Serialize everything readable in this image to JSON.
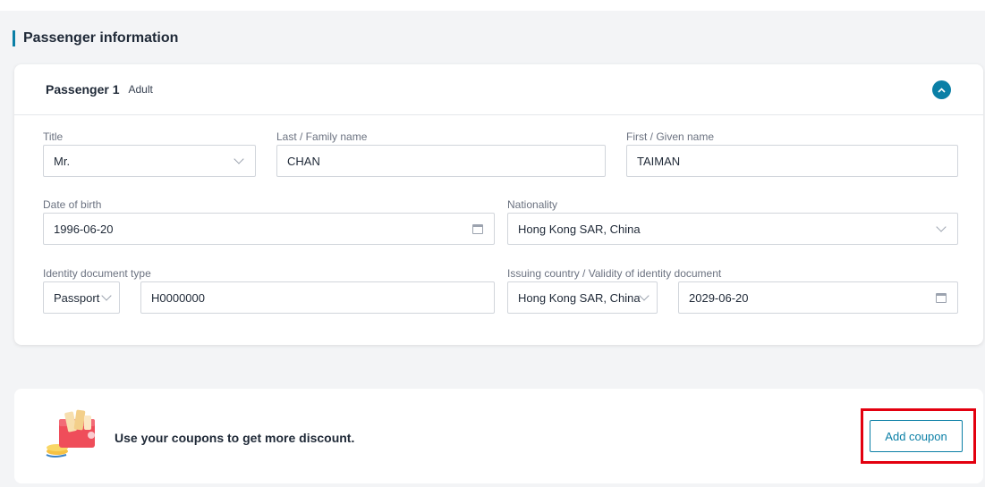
{
  "section": {
    "title": "Passenger information"
  },
  "passenger": {
    "name": "Passenger 1",
    "type": "Adult",
    "fields": {
      "title": {
        "label": "Title",
        "value": "Mr."
      },
      "last_name": {
        "label": "Last / Family name",
        "value": "CHAN"
      },
      "first_name": {
        "label": "First / Given name",
        "value": "TAIMAN"
      },
      "dob": {
        "label": "Date of birth",
        "value": "1996-06-20"
      },
      "nationality": {
        "label": "Nationality",
        "value": "Hong Kong SAR, China"
      },
      "id_doc_type": {
        "label": "Identity document type",
        "type_value": "Passport",
        "number_value": "H0000000"
      },
      "issuing": {
        "label": "Issuing country / Validity of identity document",
        "country_value": "Hong Kong SAR, China",
        "validity_value": "2029-06-20"
      }
    }
  },
  "coupon": {
    "message": "Use your coupons to get more discount.",
    "button_label": "Add coupon"
  },
  "colors": {
    "accent": "#0a7fa6",
    "highlight": "#e3000f"
  },
  "icons": [
    "chevron-up-icon",
    "chevron-down-icon",
    "calendar-icon",
    "coupon-gift-icon"
  ]
}
